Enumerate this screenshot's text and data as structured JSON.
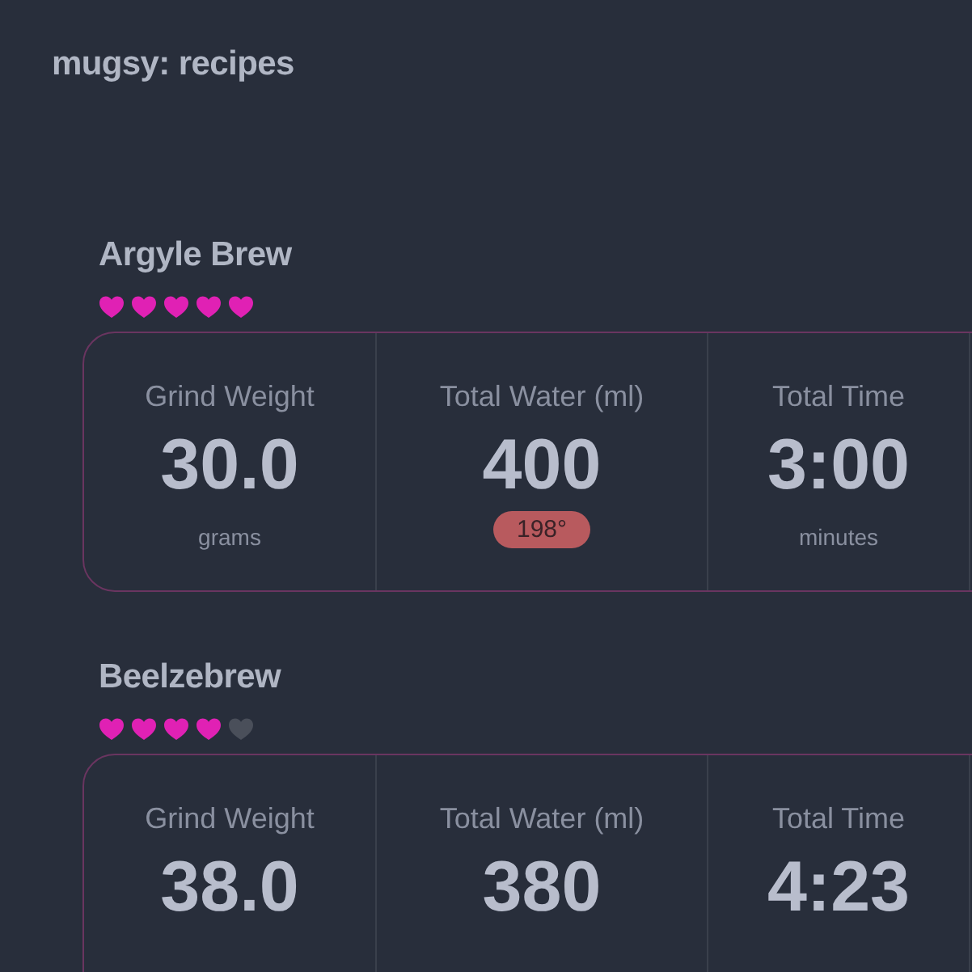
{
  "title": "mugsy: recipes",
  "recipes": [
    {
      "name": "Argyle Brew",
      "stars": 5,
      "stats": [
        {
          "label": "Grind Weight",
          "value": "30.0",
          "unit": "grams"
        },
        {
          "label": "Total Water (ml)",
          "value": "400",
          "badge": "198°"
        },
        {
          "label": "Total Time",
          "value": "3:00",
          "unit": "minutes"
        }
      ]
    },
    {
      "name": "Beelzebrew",
      "stars": 4,
      "stats": [
        {
          "label": "Grind Weight",
          "value": "38.0"
        },
        {
          "label": "Total Water (ml)",
          "value": "380"
        },
        {
          "label": "Total Time",
          "value": "4:23"
        }
      ]
    }
  ]
}
